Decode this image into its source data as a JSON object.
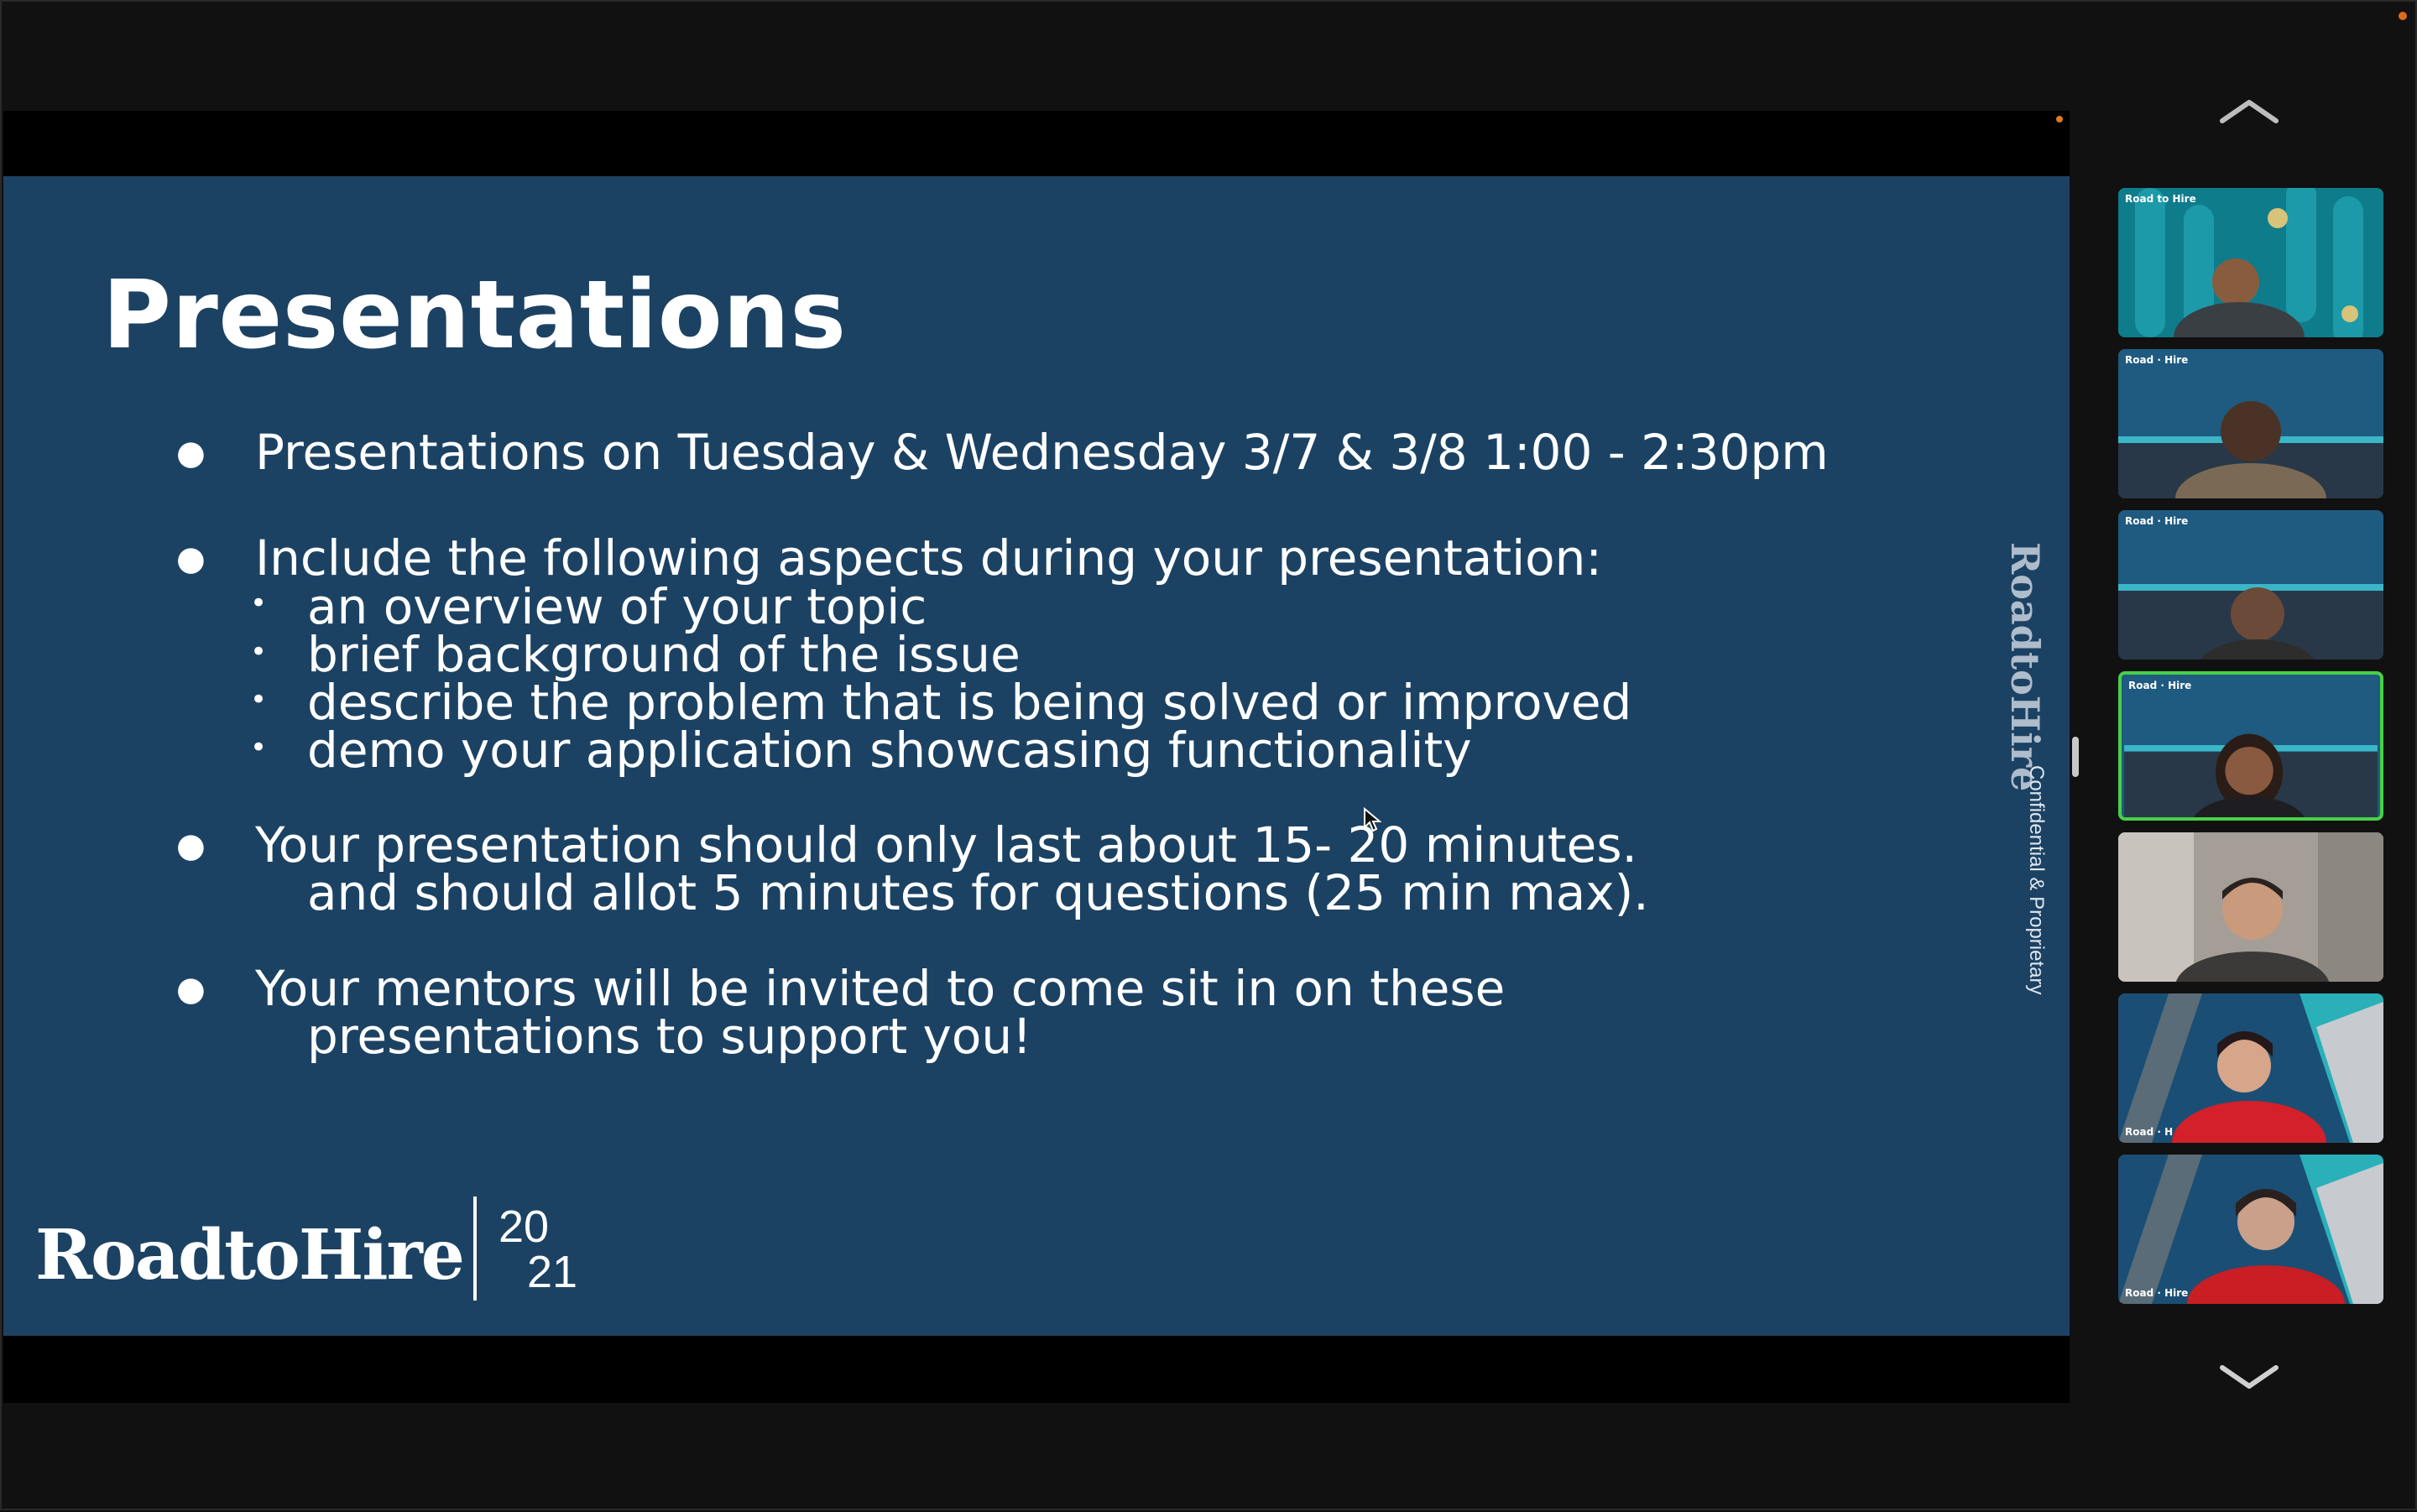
{
  "slide": {
    "title": "Presentations",
    "bullets": [
      {
        "text": "Presentations on Tuesday & Wednesday 3/7 & 3/8 1:00 - 2:30pm"
      },
      {
        "text": "Include  the following aspects during your presentation:",
        "sub": [
          "an overview of your topic",
          "brief background of the issue",
          "describe the problem that is being solved or improved",
          "demo your application showcasing functionality"
        ]
      },
      {
        "text": "Your presentation should only last about 15- 20 minutes.",
        "cont": "and should allot  5 minutes for questions (25 min max)."
      },
      {
        "text": "Your mentors will be invited to come sit in on these",
        "cont": "presentations to support you!"
      }
    ],
    "side_brand": {
      "main": "RoadtoHire",
      "sub": "Confidential & Proprietary"
    },
    "logo": {
      "name": "RoadtoHire",
      "year_top": "20",
      "year_bottom": "21"
    }
  },
  "participants": {
    "tiles": [
      {
        "label": "Road to Hire",
        "bg": "#0f7c8c",
        "active": false
      },
      {
        "label": "Road · Hire",
        "bg": "#1f5a80",
        "active": false
      },
      {
        "label": "Road · Hire",
        "bg": "#1f5a80",
        "active": false
      },
      {
        "label": "Road · Hire",
        "bg": "#1f5a80",
        "active": true
      },
      {
        "label": "",
        "bg": "#9c9690",
        "active": false
      },
      {
        "label": "Road · H",
        "bg": "#1b4e74",
        "active": false
      },
      {
        "label": "Road · Hire",
        "bg": "#1b4e74",
        "active": false
      }
    ]
  },
  "colors": {
    "slide_bg": "#1c4263",
    "active_border": "#46d146",
    "app_bg": "#111111"
  }
}
